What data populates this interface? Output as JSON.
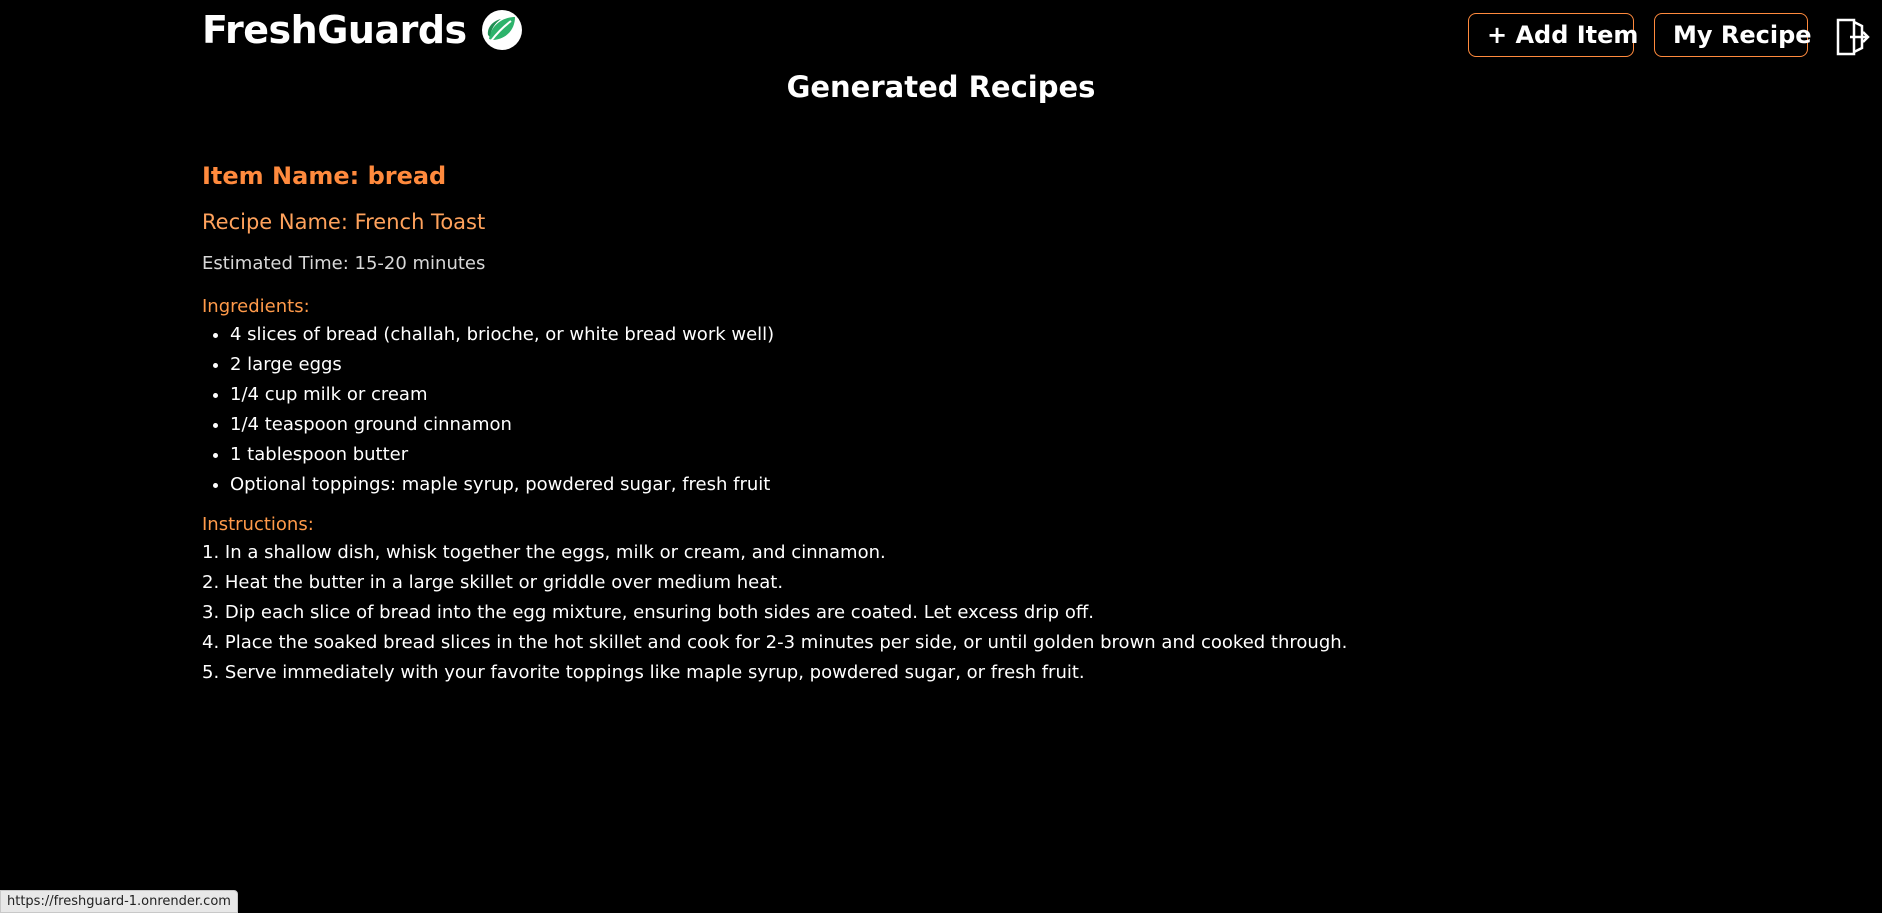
{
  "header": {
    "brand_name": "FreshGuards",
    "logo_icon": "leaf-icon",
    "add_item_label": "+ Add Item",
    "my_recipe_label": "My Recipe",
    "logout_icon": "logout-icon"
  },
  "page_title": "Generated Recipes",
  "recipe": {
    "item_name": "Item Name: bread",
    "recipe_name": "Recipe Name: French Toast",
    "estimated_time": "Estimated Time: 15-20 minutes",
    "ingredients_label": "Ingredients:",
    "ingredients": [
      "4 slices of bread (challah, brioche, or white bread work well)",
      "2 large eggs",
      "1/4 cup milk or cream",
      "1/4 teaspoon ground cinnamon",
      "1 tablespoon butter",
      "Optional toppings: maple syrup, powdered sugar, fresh fruit"
    ],
    "instructions_label": "Instructions:",
    "instructions": [
      "1. In a shallow dish, whisk together the eggs, milk or cream, and cinnamon.",
      "2. Heat the butter in a large skillet or griddle over medium heat.",
      "3. Dip each slice of bread into the egg mixture, ensuring both sides are coated. Let excess drip off.",
      "4. Place the soaked bread slices in the hot skillet and cook for 2-3 minutes per side, or until golden brown and cooked through.",
      "5. Serve immediately with your favorite toppings like maple syrup, powdered sugar, or fresh fruit."
    ]
  },
  "status_bar": {
    "url": "https://freshguard-1.onrender.com"
  },
  "colors": {
    "background": "#000000",
    "accent": "#ff8a3d",
    "text": "#ffffff"
  }
}
